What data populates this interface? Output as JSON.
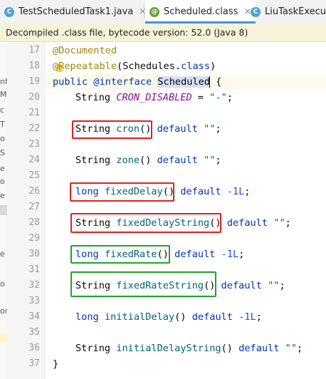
{
  "tabs": [
    {
      "label": "TestScheduledTask1.java",
      "icon": "class-icon",
      "active": false
    },
    {
      "label": "Scheduled.class",
      "icon": "annotation-icon",
      "active": true
    },
    {
      "label": "LiuTaskExecuto",
      "icon": "class-icon",
      "active": false
    }
  ],
  "banner": {
    "text": "Decompiled .class file, bytecode version: 52.0 (Java 8)"
  },
  "side_panel_chars": [
    "nf",
    "M",
    "c",
    "T",
    "o",
    "S",
    "e",
    "o",
    "e",
    "e",
    "o",
    "or"
  ],
  "gutter": {
    "line_numbers": [
      "17",
      "18",
      "19",
      "20",
      "21",
      "22",
      "23",
      "24",
      "25",
      "26",
      "27",
      "28",
      "29",
      "30",
      "31",
      "32",
      "33",
      "34",
      "35",
      "36",
      "37"
    ]
  },
  "code": {
    "l17": {
      "annotation": "@Documented"
    },
    "l18": {
      "at": "@",
      "name": "Repeatable",
      "open": "(",
      "arg": "Schedules",
      "dot": ".",
      "kw": "class",
      "close": ")"
    },
    "l19": {
      "kw1": "public",
      "kw2": "@interface",
      "name": "Scheduled",
      "brace": " {"
    },
    "l20": {
      "type": "String",
      "field": "CRON_DISABLED",
      "eq": " = ",
      "value": "\"-\"",
      "semi": ";"
    },
    "l22": {
      "type": "String",
      "method": "cron",
      "parens": "()",
      "kw": "default",
      "value": "\"\"",
      "semi": ";"
    },
    "l24": {
      "type": "String",
      "method": "zone",
      "parens": "()",
      "kw": "default",
      "value": "\"\"",
      "semi": ";"
    },
    "l26": {
      "type": "long",
      "method": "fixedDelay",
      "parens": "()",
      "kw": "default",
      "value": "-1L",
      "semi": ";"
    },
    "l28": {
      "type": "String",
      "method": "fixedDelayString",
      "parens": "()",
      "kw": "default",
      "value": "\"\"",
      "semi": ";"
    },
    "l30": {
      "type": "long",
      "method": "fixedRate",
      "parens": "()",
      "kw": "default",
      "value": "-1L",
      "semi": ";"
    },
    "l32": {
      "type": "String",
      "method": "fixedRateString",
      "parens": "()",
      "kw": "default",
      "value": "\"\"",
      "semi": ";"
    },
    "l34": {
      "type": "long",
      "method": "initialDelay",
      "parens": "()",
      "kw": "default",
      "value": "-1L",
      "semi": ";"
    },
    "l36": {
      "type": "String",
      "method": "initialDelayString",
      "parens": "()",
      "kw": "default",
      "value": "\"\"",
      "semi": ";"
    },
    "l37": {
      "brace": "}"
    }
  },
  "colors": {
    "keyword": "#0033b3",
    "annotation": "#9e880d",
    "string": "#067d17",
    "number": "#1750eb",
    "field": "#871094",
    "red_box": "#e0201b",
    "green_box": "#1fa32a"
  }
}
